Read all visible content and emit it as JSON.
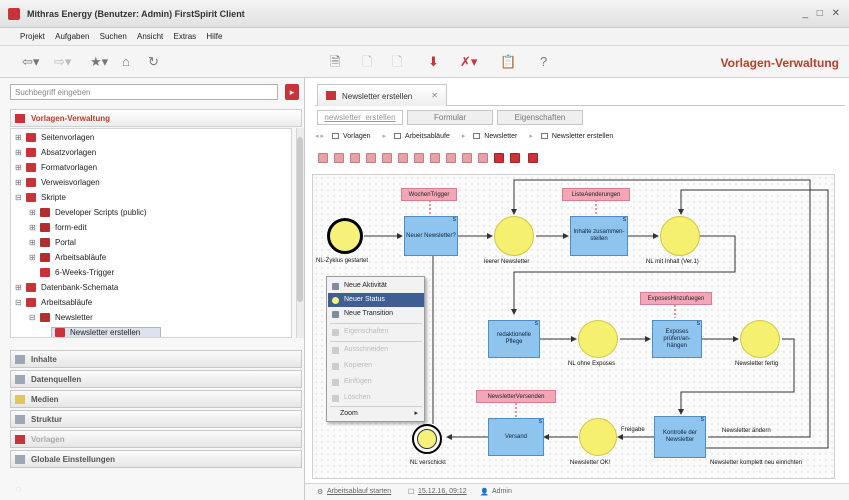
{
  "window": {
    "title": "Mithras Energy (Benutzer: Admin) FirstSpirit Client",
    "controls": "_ □ ✕"
  },
  "menu": [
    "Projekt",
    "Aufgaben",
    "Suchen",
    "Ansicht",
    "Extras",
    "Hilfe"
  ],
  "toolbar": {
    "title": "Vorlagen-Verwaltung"
  },
  "search": {
    "placeholder": "Suchbegriff eingeben"
  },
  "panel": {
    "title": "Vorlagen-Verwaltung"
  },
  "tree": [
    {
      "label": "Seitenvorlagen"
    },
    {
      "label": "Absatzvorlagen"
    },
    {
      "label": "Formatvorlagen"
    },
    {
      "label": "Verweisvorlagen"
    },
    {
      "label": "Skripte"
    },
    {
      "label": "Developer Scripts (public)"
    },
    {
      "label": "form-edit"
    },
    {
      "label": "Portal"
    },
    {
      "label": "Arbeitsabläufe"
    },
    {
      "label": "6-Weeks-Trigger"
    },
    {
      "label": "Datenbank-Schemata"
    },
    {
      "label": "Arbeitsabläufe"
    },
    {
      "label": "Newsletter"
    },
    {
      "label": "Newsletter erstellen"
    }
  ],
  "accordion": [
    "Inhalte",
    "Datenquellen",
    "Medien",
    "Struktur",
    "Vorlagen",
    "Globale Einstellungen"
  ],
  "editor": {
    "tab_label": "Newsletter erstellen",
    "subtabs": [
      "newsletter_erstellen",
      "Formular",
      "Eigenschaften"
    ],
    "breadcrumb": [
      "Vorlagen",
      "Arbeitsabläufe",
      "Newsletter",
      "Newsletter erstellen"
    ]
  },
  "workflow": {
    "triggers": {
      "t1": "WochenTrigger",
      "t2": "ListeAenderungen",
      "t3": "ExposesHinzufuegen",
      "t4": "NewsletterVersenden"
    },
    "activities": {
      "a1": "Neuer Newsletter?",
      "a2": "Inhalte zusammen-stellen",
      "a3": "redaktionelle Pflege",
      "a4": "Exposes prüfen/an-hängen",
      "a5": "Versand",
      "a6": "Kontrolle der Newsletter"
    },
    "labels": {
      "start": "NL-Zyklus gestartet",
      "s1": "leerer Newsletter",
      "s2": "NL mit Inhalt (Ver.1)",
      "s3": "NL ohne Exposes",
      "s4": "Newsletter fertig",
      "s5": "Newsletter OK!",
      "end": "NL verschickt",
      "freigabe": "Freigabe",
      "aendern": "Newsletter ändern",
      "neu": "Newsletter komplett neu einrichten"
    },
    "corner_mark": "S"
  },
  "context_menu": {
    "items": [
      "Neue Aktivität",
      "Neuer Status",
      "Neue Transition",
      "Eigenschaften",
      "Ausschneiden",
      "Kopieren",
      "Einfügen",
      "Löschen",
      "Zoom"
    ],
    "selected": "Neuer Status",
    "submenu_arrow": "▸"
  },
  "status": {
    "link": "Arbeitsablauf starten",
    "date": "15.12.16, 09:12",
    "user": "Admin"
  },
  "colors": {
    "accent": "#c8333a",
    "activity": "#8ec4ee",
    "state": "#f5f06f",
    "trigger": "#f3a6b6",
    "selection": "#3f5f93"
  }
}
